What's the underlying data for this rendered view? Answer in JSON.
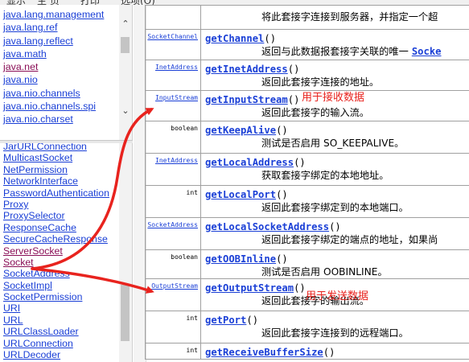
{
  "menubar": {
    "items": [
      "显示",
      "主 页",
      "打印",
      "选项(O)"
    ]
  },
  "packages": [
    {
      "name": "java.lang.management",
      "visited": false
    },
    {
      "name": "java.lang.ref",
      "visited": false
    },
    {
      "name": "java.lang.reflect",
      "visited": false
    },
    {
      "name": "java.math",
      "visited": false
    },
    {
      "name": "java.net",
      "visited": true
    },
    {
      "name": "java.nio",
      "visited": false
    },
    {
      "name": "java.nio.channels",
      "visited": false
    },
    {
      "name": "java.nio.channels.spi",
      "visited": false
    },
    {
      "name": "java.nio.charset",
      "visited": false
    }
  ],
  "classes": [
    {
      "name": "JarURLConnection",
      "visited": false
    },
    {
      "name": "MulticastSocket",
      "visited": false
    },
    {
      "name": "NetPermission",
      "visited": false
    },
    {
      "name": "NetworkInterface",
      "visited": false
    },
    {
      "name": "PasswordAuthentication",
      "visited": false
    },
    {
      "name": "Proxy",
      "visited": false
    },
    {
      "name": "ProxySelector",
      "visited": false
    },
    {
      "name": "ResponseCache",
      "visited": false
    },
    {
      "name": "SecureCacheResponse",
      "visited": false
    },
    {
      "name": "ServerSocket",
      "visited": true
    },
    {
      "name": "Socket",
      "visited": true
    },
    {
      "name": "SocketAddress",
      "visited": false
    },
    {
      "name": "SocketImpl",
      "visited": false
    },
    {
      "name": "SocketPermission",
      "visited": false
    },
    {
      "name": "URI",
      "visited": false
    },
    {
      "name": "URL",
      "visited": false
    },
    {
      "name": "URLClassLoader",
      "visited": false
    },
    {
      "name": "URLConnection",
      "visited": false
    },
    {
      "name": "URLDecoder",
      "visited": false
    }
  ],
  "methods": [
    {
      "type": "",
      "type_link": false,
      "name": "",
      "params": "",
      "desc": "将此套接字连接到服务器，并指定一个超",
      "desc_more": ""
    },
    {
      "type": "SocketChannel",
      "type_link": true,
      "name": "getChannel",
      "params": "()",
      "desc": "返回与此数据报套接字关联的唯一",
      "desc_more": "Socke"
    },
    {
      "type": "InetAddress",
      "type_link": true,
      "name": "getInetAddress",
      "params": "()",
      "desc": "返回此套接字连接的地址。",
      "desc_more": ""
    },
    {
      "type": "InputStream",
      "type_link": true,
      "name": "getInputStream",
      "params": "()",
      "desc": "返回此套接字的输入流。",
      "desc_more": ""
    },
    {
      "type": "boolean",
      "type_link": false,
      "name": "getKeepAlive",
      "params": "()",
      "desc": "测试是否启用 SO_KEEPALIVE。",
      "desc_more": ""
    },
    {
      "type": "InetAddress",
      "type_link": true,
      "name": "getLocalAddress",
      "params": "()",
      "desc": "获取套接字绑定的本地地址。",
      "desc_more": ""
    },
    {
      "type": "int",
      "type_link": false,
      "name": "getLocalPort",
      "params": "()",
      "desc": "返回此套接字绑定到的本地端口。",
      "desc_more": ""
    },
    {
      "type": "SocketAddress",
      "type_link": true,
      "name": "getLocalSocketAddress",
      "params": "()",
      "desc": "返回此套接字绑定的端点的地址，如果尚",
      "desc_more": ""
    },
    {
      "type": "boolean",
      "type_link": false,
      "name": "getOOBInline",
      "params": "()",
      "desc": "测试是否启用 OOBINLINE。",
      "desc_more": ""
    },
    {
      "type": "OutputStream",
      "type_link": true,
      "name": "getOutputStream",
      "params": "()",
      "desc": "返回此套接字的输出流。",
      "desc_more": ""
    },
    {
      "type": "int",
      "type_link": false,
      "name": "getPort",
      "params": "()",
      "desc": "返回此套接字连接到的远程端口。",
      "desc_more": ""
    },
    {
      "type": "int",
      "type_link": false,
      "name": "getReceiveBufferSize",
      "params": "()",
      "desc": "",
      "desc_more": ""
    }
  ],
  "annotations": {
    "input_note": "用于接收数据",
    "output_note": "用于发送数据",
    "color": "#e8231e"
  },
  "colors": {
    "link": "#1a3fd6",
    "visited_link": "#8a0f57"
  }
}
